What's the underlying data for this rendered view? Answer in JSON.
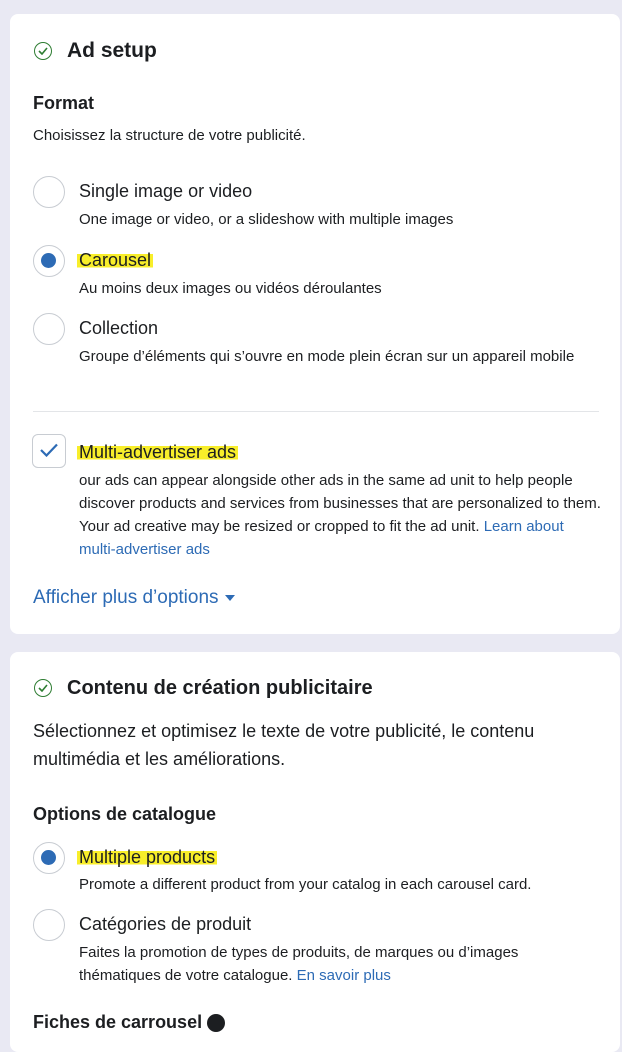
{
  "ad_setup": {
    "title": "Ad setup",
    "format_heading": "Format",
    "format_description": "Choisissez la structure de votre publicité.",
    "format_options": [
      {
        "label": "Single image or video",
        "description": "One image or video, or a slideshow with multiple images",
        "selected": false
      },
      {
        "label": "Carousel",
        "description": "Au moins deux images ou vidéos déroulantes",
        "selected": true
      },
      {
        "label": "Collection",
        "description": "Groupe d’éléments qui s’ouvre en mode plein écran sur un appareil mobile",
        "selected": false
      }
    ],
    "multi_advertiser": {
      "label": "Multi-advertiser ads",
      "checked": true,
      "description": "our ads can appear alongside other ads in the same ad unit to help people discover products and services from businesses that are personalized to them. Your ad creative may be resized or cropped to fit the ad unit.",
      "link": "Learn about multi-advertiser ads"
    },
    "more_options": "Afficher plus d’options"
  },
  "creative": {
    "title": "Contenu de création publicitaire",
    "description": "Sélectionnez et optimisez le texte de votre publicité, le contenu multimédia et les améliorations.",
    "catalog_heading": "Options de catalogue",
    "catalog_options": [
      {
        "label": "Multiple products",
        "description": "Promote a different product from your catalog in each carousel card.",
        "selected": true
      },
      {
        "label": "Catégories de produit",
        "description": "Faites la promotion de types de produits, de marques ou d’images thématiques de votre catalogue.",
        "link": "En savoir plus",
        "selected": false
      }
    ],
    "cards_heading": "Fiches de carrousel"
  },
  "colors": {
    "accent": "#2d6bb5",
    "success": "#2e7d32",
    "highlight": "#f8ee2a"
  }
}
